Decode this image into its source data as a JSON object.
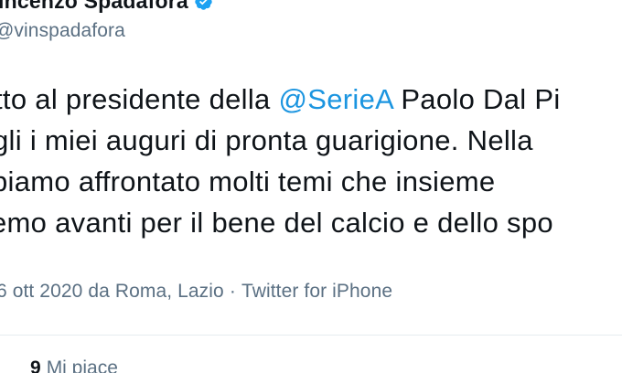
{
  "user": {
    "display_name": "incenzo Spadafora",
    "handle": "@vinspadafora",
    "verified_icon": "verified-badge-icon",
    "verified_color": "#1da1f2"
  },
  "tweet": {
    "lines": [
      {
        "before": "tto al presidente della ",
        "mention": "@SerieA",
        "after": " Paolo Dal Pi"
      },
      {
        "text": "gli i miei auguri di pronta guarigione. Nella"
      },
      {
        "text": "biamo affrontato molti temi che insieme"
      },
      {
        "text": "emo avanti per il bene del calcio e dello spo"
      }
    ],
    "mention_color": "#1b95e0"
  },
  "meta": {
    "date_location": "6 ott 2020 da Roma, Lazio",
    "separator": "·",
    "source": "Twitter for iPhone"
  },
  "engagement": {
    "likes_count": "9",
    "likes_label": "Mi piace"
  }
}
